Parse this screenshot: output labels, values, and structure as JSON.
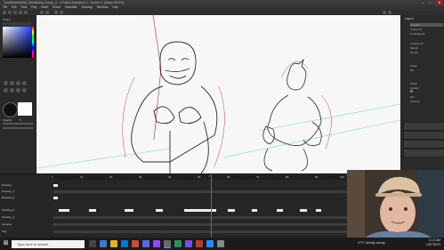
{
  "window": {
    "title": "Tumbleweed/Hel_Sweatdrop_Comp_2 - 1.Fallen Animation 2 / Scene 1* (Maya 2019.2)",
    "controls": {
      "minimize": "—",
      "maximize": "☐",
      "close": "✕"
    }
  },
  "menu": [
    "File",
    "Edit",
    "View",
    "Play",
    "Insert",
    "Scene",
    "Animation",
    "Drawing",
    "Windows",
    "Help"
  ],
  "left_panel": {
    "color_label": "Colour",
    "brush_size": "5",
    "opacity_label": "Opacity",
    "swatches": [
      "#000000",
      "#ffffff",
      "#e03030",
      "#3060e0",
      "#30a040",
      "#f0c000"
    ]
  },
  "right_panel": {
    "header": "Layers",
    "items": [
      "Line Art",
      "Colour Art",
      "Underlay Art",
      "Overlay Art",
      "Sketch",
      "Rough",
      "Clean",
      "BG",
      "Notes",
      "Guides",
      "Ref",
      "Camera"
    ],
    "selected_index": 0
  },
  "timeline": {
    "layers": [
      "Drawing",
      "Drawing_1",
      "Drawing_2",
      "Drawing_3",
      "Drawing_4",
      "Camera",
      "Peg"
    ],
    "frame_labels": [
      "1",
      "10",
      "20",
      "30",
      "40",
      "50",
      "60",
      "70",
      "80",
      "90",
      "100"
    ],
    "playhead_frame": "55"
  },
  "taskbar": {
    "search_placeholder": "Type here to search",
    "weather": "27°C Mostly cloudy",
    "time": "11:21 AM",
    "date": "10/27/2021"
  },
  "colors": {
    "accent": "#3aa0e0",
    "sketch_red": "#c24070",
    "line_black": "#2a2a2a",
    "guide_teal": "#7fd8c8"
  }
}
